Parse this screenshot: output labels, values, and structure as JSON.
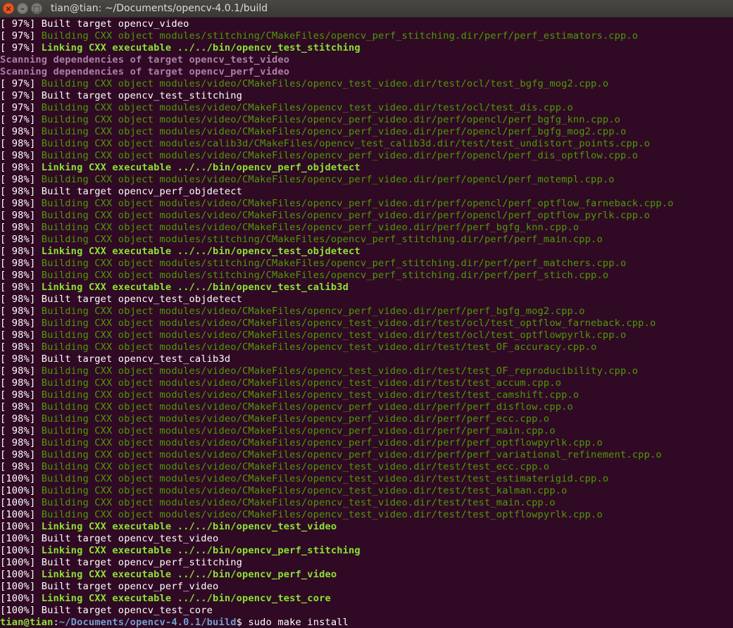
{
  "window": {
    "title": "tian@tian: ~/Documents/opencv-4.0.1/build",
    "close_glyph": "×",
    "minimize_glyph": "–",
    "maximize_glyph": "□"
  },
  "colors": {
    "background": "#300a24",
    "building_text": "#4e9a06",
    "linking_text": "#8ae234",
    "scanning_text": "#ad7fa8",
    "prompt_path": "#729fcf"
  },
  "terminal": {
    "lines": [
      {
        "pct": "[ 97%]",
        "type": "built",
        "text": " Built target opencv_video"
      },
      {
        "pct": "[ 97%]",
        "type": "build",
        "text": " Building CXX object modules/stitching/CMakeFiles/opencv_perf_stitching.dir/perf/perf_estimators.cpp.o"
      },
      {
        "pct": "[ 97%]",
        "type": "link",
        "text": " Linking CXX executable ../../bin/opencv_test_stitching"
      },
      {
        "pct": "",
        "type": "scan",
        "text": "Scanning dependencies of target opencv_test_video"
      },
      {
        "pct": "",
        "type": "scan",
        "text": "Scanning dependencies of target opencv_perf_video"
      },
      {
        "pct": "[ 97%]",
        "type": "build",
        "text": " Building CXX object modules/video/CMakeFiles/opencv_test_video.dir/test/ocl/test_bgfg_mog2.cpp.o"
      },
      {
        "pct": "[ 97%]",
        "type": "built",
        "text": " Built target opencv_test_stitching"
      },
      {
        "pct": "[ 97%]",
        "type": "build",
        "text": " Building CXX object modules/video/CMakeFiles/opencv_test_video.dir/test/ocl/test_dis.cpp.o"
      },
      {
        "pct": "[ 97%]",
        "type": "build",
        "text": " Building CXX object modules/video/CMakeFiles/opencv_perf_video.dir/perf/opencl/perf_bgfg_knn.cpp.o"
      },
      {
        "pct": "[ 98%]",
        "type": "build",
        "text": " Building CXX object modules/video/CMakeFiles/opencv_perf_video.dir/perf/opencl/perf_bgfg_mog2.cpp.o"
      },
      {
        "pct": "[ 98%]",
        "type": "build",
        "text": " Building CXX object modules/calib3d/CMakeFiles/opencv_test_calib3d.dir/test/test_undistort_points.cpp.o"
      },
      {
        "pct": "[ 98%]",
        "type": "build",
        "text": " Building CXX object modules/video/CMakeFiles/opencv_perf_video.dir/perf/opencl/perf_dis_optflow.cpp.o"
      },
      {
        "pct": "[ 98%]",
        "type": "link",
        "text": " Linking CXX executable ../../bin/opencv_perf_objdetect"
      },
      {
        "pct": "[ 98%]",
        "type": "build",
        "text": " Building CXX object modules/video/CMakeFiles/opencv_perf_video.dir/perf/opencl/perf_motempl.cpp.o"
      },
      {
        "pct": "[ 98%]",
        "type": "built",
        "text": " Built target opencv_perf_objdetect"
      },
      {
        "pct": "[ 98%]",
        "type": "build",
        "text": " Building CXX object modules/video/CMakeFiles/opencv_perf_video.dir/perf/opencl/perf_optflow_farneback.cpp.o"
      },
      {
        "pct": "[ 98%]",
        "type": "build",
        "text": " Building CXX object modules/video/CMakeFiles/opencv_perf_video.dir/perf/opencl/perf_optflow_pyrlk.cpp.o"
      },
      {
        "pct": "[ 98%]",
        "type": "build",
        "text": " Building CXX object modules/video/CMakeFiles/opencv_perf_video.dir/perf/perf_bgfg_knn.cpp.o"
      },
      {
        "pct": "[ 98%]",
        "type": "build",
        "text": " Building CXX object modules/stitching/CMakeFiles/opencv_perf_stitching.dir/perf/perf_main.cpp.o"
      },
      {
        "pct": "[ 98%]",
        "type": "link",
        "text": " Linking CXX executable ../../bin/opencv_test_objdetect"
      },
      {
        "pct": "[ 98%]",
        "type": "build",
        "text": " Building CXX object modules/stitching/CMakeFiles/opencv_perf_stitching.dir/perf/perf_matchers.cpp.o"
      },
      {
        "pct": "[ 98%]",
        "type": "build",
        "text": " Building CXX object modules/stitching/CMakeFiles/opencv_perf_stitching.dir/perf/perf_stich.cpp.o"
      },
      {
        "pct": "[ 98%]",
        "type": "link",
        "text": " Linking CXX executable ../../bin/opencv_test_calib3d"
      },
      {
        "pct": "[ 98%]",
        "type": "built",
        "text": " Built target opencv_test_objdetect"
      },
      {
        "pct": "[ 98%]",
        "type": "build",
        "text": " Building CXX object modules/video/CMakeFiles/opencv_perf_video.dir/perf/perf_bgfg_mog2.cpp.o"
      },
      {
        "pct": "[ 98%]",
        "type": "build",
        "text": " Building CXX object modules/video/CMakeFiles/opencv_test_video.dir/test/ocl/test_optflow_farneback.cpp.o"
      },
      {
        "pct": "[ 98%]",
        "type": "build",
        "text": " Building CXX object modules/video/CMakeFiles/opencv_test_video.dir/test/ocl/test_optflowpyrlk.cpp.o"
      },
      {
        "pct": "[ 98%]",
        "type": "build",
        "text": " Building CXX object modules/video/CMakeFiles/opencv_test_video.dir/test/test_OF_accuracy.cpp.o"
      },
      {
        "pct": "[ 98%]",
        "type": "built",
        "text": " Built target opencv_test_calib3d"
      },
      {
        "pct": "[ 98%]",
        "type": "build",
        "text": " Building CXX object modules/video/CMakeFiles/opencv_test_video.dir/test/test_OF_reproducibility.cpp.o"
      },
      {
        "pct": "[ 98%]",
        "type": "build",
        "text": " Building CXX object modules/video/CMakeFiles/opencv_test_video.dir/test/test_accum.cpp.o"
      },
      {
        "pct": "[ 98%]",
        "type": "build",
        "text": " Building CXX object modules/video/CMakeFiles/opencv_test_video.dir/test/test_camshift.cpp.o"
      },
      {
        "pct": "[ 98%]",
        "type": "build",
        "text": " Building CXX object modules/video/CMakeFiles/opencv_perf_video.dir/perf/perf_disflow.cpp.o"
      },
      {
        "pct": "[ 98%]",
        "type": "build",
        "text": " Building CXX object modules/video/CMakeFiles/opencv_perf_video.dir/perf/perf_ecc.cpp.o"
      },
      {
        "pct": "[ 98%]",
        "type": "build",
        "text": " Building CXX object modules/video/CMakeFiles/opencv_perf_video.dir/perf/perf_main.cpp.o"
      },
      {
        "pct": "[ 98%]",
        "type": "build",
        "text": " Building CXX object modules/video/CMakeFiles/opencv_perf_video.dir/perf/perf_optflowpyrlk.cpp.o"
      },
      {
        "pct": "[ 98%]",
        "type": "build",
        "text": " Building CXX object modules/video/CMakeFiles/opencv_perf_video.dir/perf/perf_variational_refinement.cpp.o"
      },
      {
        "pct": "[ 98%]",
        "type": "build",
        "text": " Building CXX object modules/video/CMakeFiles/opencv_test_video.dir/test/test_ecc.cpp.o"
      },
      {
        "pct": "[100%]",
        "type": "build",
        "text": " Building CXX object modules/video/CMakeFiles/opencv_test_video.dir/test/test_estimaterigid.cpp.o"
      },
      {
        "pct": "[100%]",
        "type": "build",
        "text": " Building CXX object modules/video/CMakeFiles/opencv_test_video.dir/test/test_kalman.cpp.o"
      },
      {
        "pct": "[100%]",
        "type": "build",
        "text": " Building CXX object modules/video/CMakeFiles/opencv_test_video.dir/test/test_main.cpp.o"
      },
      {
        "pct": "[100%]",
        "type": "build",
        "text": " Building CXX object modules/video/CMakeFiles/opencv_test_video.dir/test/test_optflowpyrlk.cpp.o"
      },
      {
        "pct": "[100%]",
        "type": "link",
        "text": " Linking CXX executable ../../bin/opencv_test_video"
      },
      {
        "pct": "[100%]",
        "type": "built",
        "text": " Built target opencv_test_video"
      },
      {
        "pct": "[100%]",
        "type": "link",
        "text": " Linking CXX executable ../../bin/opencv_perf_stitching"
      },
      {
        "pct": "[100%]",
        "type": "built",
        "text": " Built target opencv_perf_stitching"
      },
      {
        "pct": "[100%]",
        "type": "link",
        "text": " Linking CXX executable ../../bin/opencv_perf_video"
      },
      {
        "pct": "[100%]",
        "type": "built",
        "text": " Built target opencv_perf_video"
      },
      {
        "pct": "[100%]",
        "type": "link",
        "text": " Linking CXX executable ../../bin/opencv_test_core"
      },
      {
        "pct": "[100%]",
        "type": "built",
        "text": " Built target opencv_test_core"
      }
    ],
    "prompt": {
      "user_host": "tian@tian",
      "separator": ":",
      "path": "~/Documents/opencv-4.0.1/build",
      "symbol": "$ ",
      "command": "sudo make install"
    }
  }
}
